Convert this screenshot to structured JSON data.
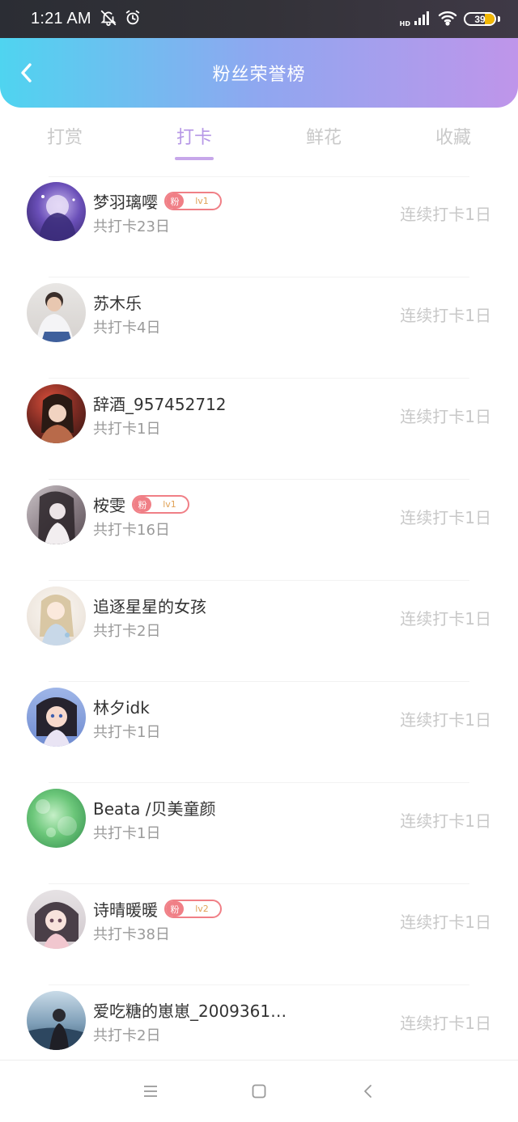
{
  "status_bar": {
    "time": "1:21 AM",
    "network_label": "HD",
    "battery_level": "39",
    "icons": [
      "bell-muted-icon",
      "alarm-icon",
      "signal-icon",
      "wifi-icon",
      "battery-icon"
    ]
  },
  "header": {
    "title": "粉丝荣誉榜",
    "back_icon": "chevron-left-icon",
    "gradient": [
      "#4fd4f0",
      "#8fa7f0",
      "#bf95ea"
    ]
  },
  "tabs": [
    {
      "label": "打赏",
      "active": false
    },
    {
      "label": "打卡",
      "active": true
    },
    {
      "label": "鲜花",
      "active": false
    },
    {
      "label": "收藏",
      "active": false
    }
  ],
  "accent_color": "#b697e6",
  "fans": [
    {
      "name": "梦羽璃嘤",
      "badge": {
        "prefix": "粉",
        "level": "lv1"
      },
      "total": "共打卡23日",
      "streak": "连续打卡1日"
    },
    {
      "name": "苏木乐",
      "badge": null,
      "total": "共打卡4日",
      "streak": "连续打卡1日"
    },
    {
      "name": "辞酒_957452712",
      "badge": null,
      "total": "共打卡1日",
      "streak": "连续打卡1日"
    },
    {
      "name": "桉雯",
      "badge": {
        "prefix": "粉",
        "level": "lv1"
      },
      "total": "共打卡16日",
      "streak": "连续打卡1日"
    },
    {
      "name": "追逐星星的女孩",
      "badge": null,
      "total": "共打卡2日",
      "streak": "连续打卡1日"
    },
    {
      "name": "林夕idk",
      "badge": null,
      "total": "共打卡1日",
      "streak": "连续打卡1日"
    },
    {
      "name": "Beata /贝美童颜",
      "badge": null,
      "total": "共打卡1日",
      "streak": "连续打卡1日"
    },
    {
      "name": "诗晴暖暖",
      "badge": {
        "prefix": "粉",
        "level": "lv2"
      },
      "total": "共打卡38日",
      "streak": "连续打卡1日"
    },
    {
      "name": "爱吃糖的崽崽_20093618...",
      "badge": null,
      "total": "共打卡2日",
      "streak": "连续打卡1日"
    }
  ],
  "nav_bar": {
    "icons": [
      "menu-icon",
      "home-square-icon",
      "back-triangle-icon"
    ]
  }
}
